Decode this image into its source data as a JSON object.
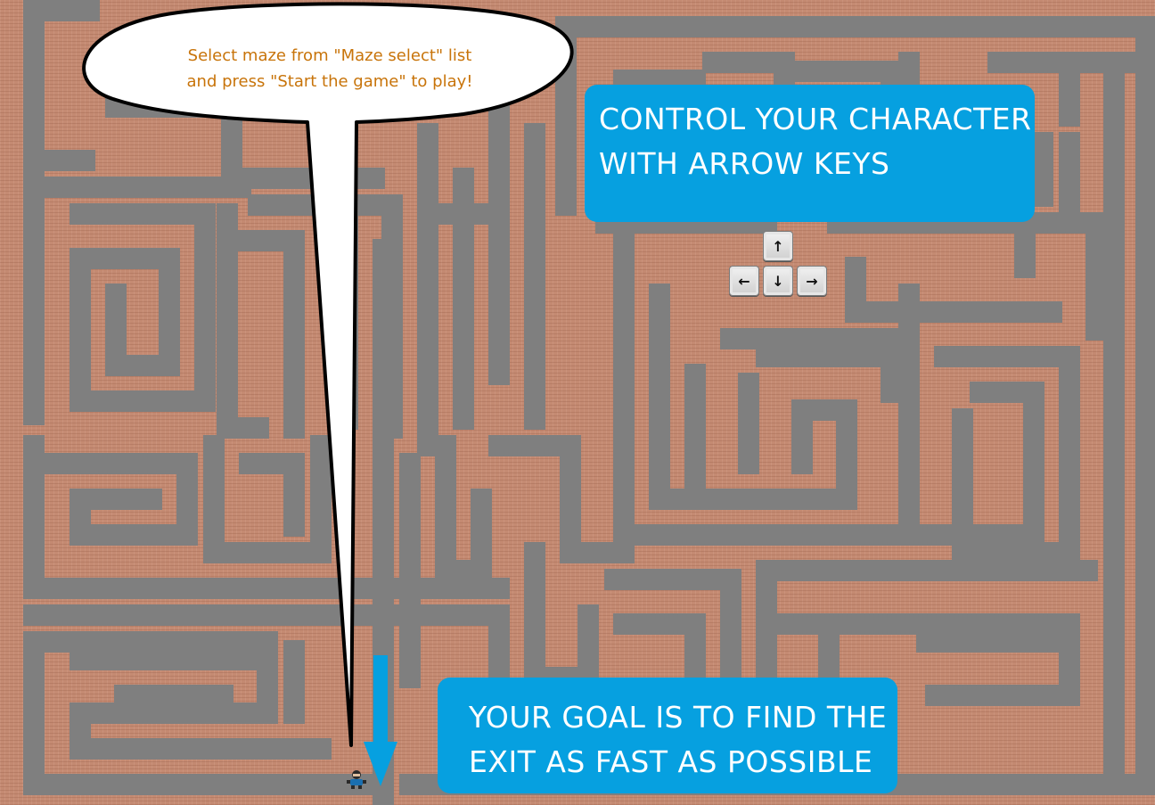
{
  "bubble": {
    "line1": "Select maze from \"Maze select\" list",
    "line2": "and press \"Start the game\" to play!"
  },
  "controls_panel": {
    "line1": "CONTROL YOUR CHARACTER",
    "line2": "WITH ARROW KEYS"
  },
  "goal_panel": {
    "line1": "YOUR GOAL IS TO FIND THE",
    "line2": "EXIT AS FAST AS POSSIBLE"
  },
  "keys": {
    "up": "↑",
    "left": "←",
    "down": "↓",
    "right": "→"
  },
  "colors": {
    "brick": "#c48a72",
    "path": "#7f7f7f",
    "panel": "#06a0e0",
    "bubble_text": "#c8740a"
  },
  "icons": {
    "player": "player-character-icon",
    "exit_arrow": "down-arrow-icon"
  }
}
